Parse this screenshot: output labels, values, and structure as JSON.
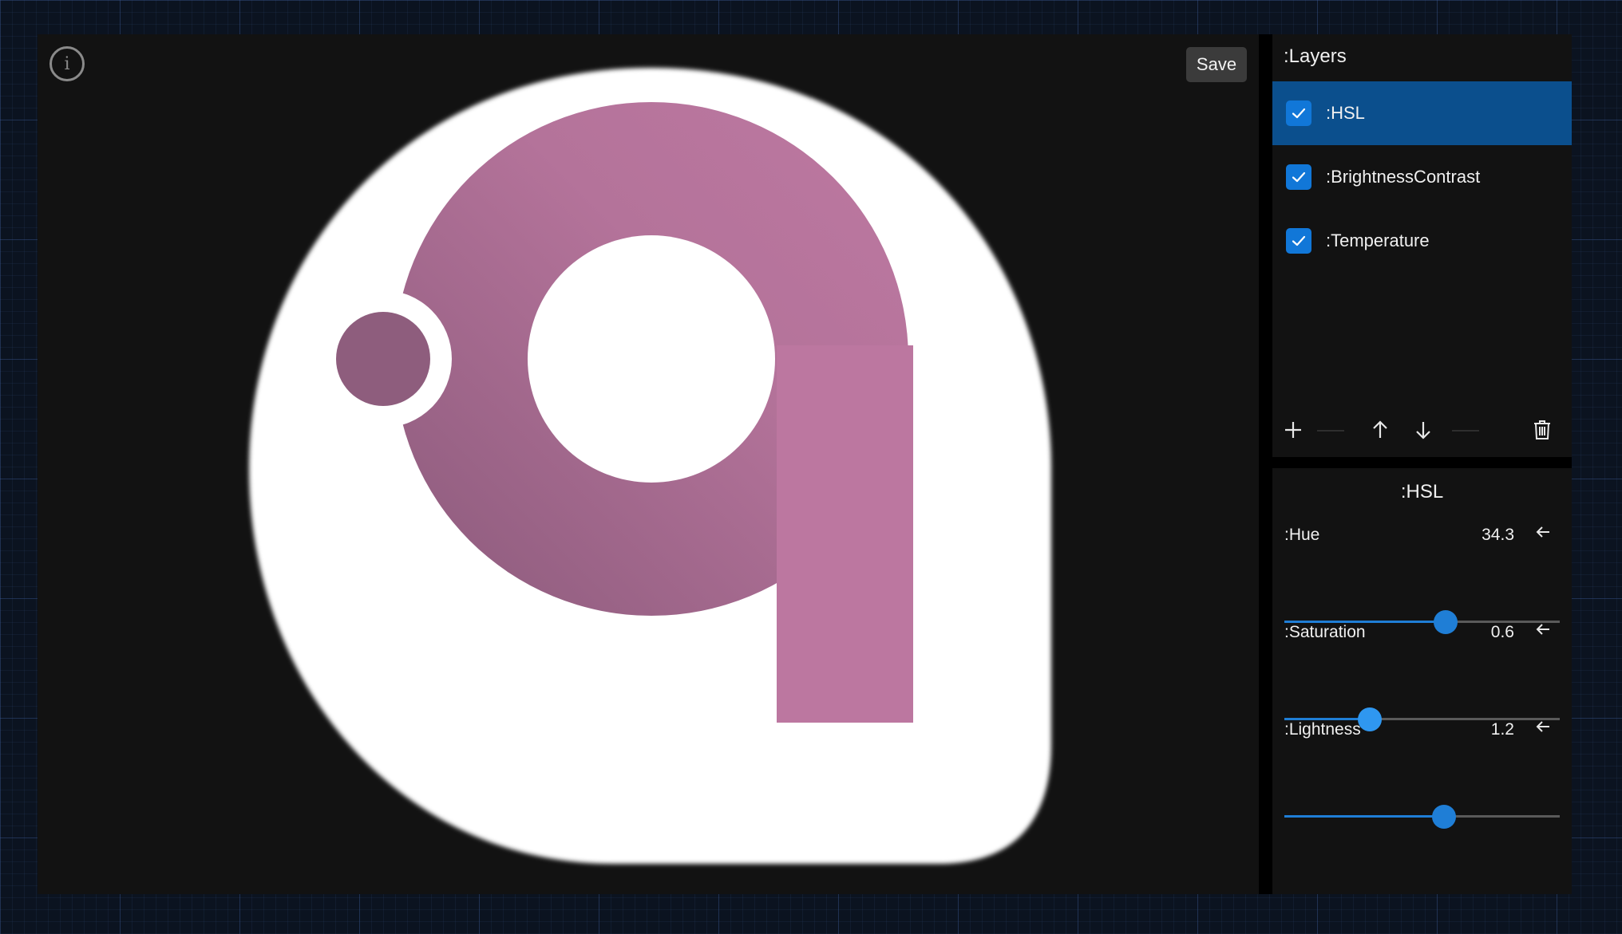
{
  "toolbar": {
    "save_label": "Save",
    "info_glyph": "i"
  },
  "layers": {
    "title": ":Layers",
    "items": [
      {
        "label": ":HSL",
        "checked": true,
        "selected": true
      },
      {
        "label": ":BrightnessContrast",
        "checked": true,
        "selected": false
      },
      {
        "label": ":Temperature",
        "checked": true,
        "selected": false
      }
    ],
    "actions": [
      "plus-icon",
      "arrow-up-icon",
      "arrow-down-icon",
      "trash-icon"
    ]
  },
  "properties": {
    "title": ":HSL",
    "sliders": [
      {
        "label": ":Hue",
        "value": "34.3",
        "fraction": 0.585
      },
      {
        "label": ":Saturation",
        "value": "0.6",
        "fraction": 0.31
      },
      {
        "label": ":Lightness",
        "value": "1.2",
        "fraction": 0.58
      }
    ]
  },
  "colors": {
    "accent": "#1177d8",
    "selected_row": "#0b4f8d",
    "logo_pink": "#bc77a0",
    "logo_dark": "#8e5d7d"
  }
}
